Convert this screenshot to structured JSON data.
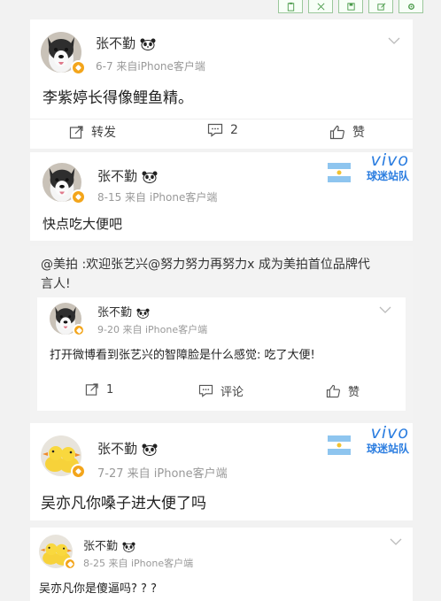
{
  "toolbar": {
    "icons": [
      "clipboard-icon",
      "crop-icon",
      "save-icon",
      "edit-icon",
      "settings-icon"
    ]
  },
  "post1": {
    "username": "张不勤",
    "meta": "6-7  来自iPhone客户端",
    "content": "李紫婷长得像鲤鱼精。",
    "actions": {
      "repost": "转发",
      "comment": "2",
      "like": "赞"
    }
  },
  "post2": {
    "username": "张不勤",
    "meta": "8-15  来自 iPhone客户端",
    "content": "快点吃大便吧",
    "watermark": {
      "brand": "vivo",
      "club": "球迷站队"
    },
    "quoted": {
      "line1": "@美拍 :欢迎张艺兴@努力努力再努力x 成为美拍首位品牌代",
      "line2": "言人!"
    },
    "inner": {
      "username": "张不勤",
      "meta": "9-20  来自 iPhone客户端",
      "content": "打开微博看到张艺兴的智障脸是什么感觉: 吃了大便!",
      "actions": {
        "repost": "1",
        "comment": "评论",
        "like": "赞"
      }
    }
  },
  "post3": {
    "username": "张不勤",
    "meta": "7-27  来自 iPhone客户端",
    "content": "吴亦凡你嗓子进大便了吗",
    "watermark": {
      "brand": "vivo",
      "club": "球迷站队"
    }
  },
  "post4": {
    "username": "张不勤",
    "meta": "8-25  来自 iPhone客户端",
    "content": "吴亦凡你是傻逼吗? ? ?"
  },
  "colors": {
    "accent": "#2b7de0",
    "badge": "#f3a51b",
    "meta": "#999999"
  }
}
